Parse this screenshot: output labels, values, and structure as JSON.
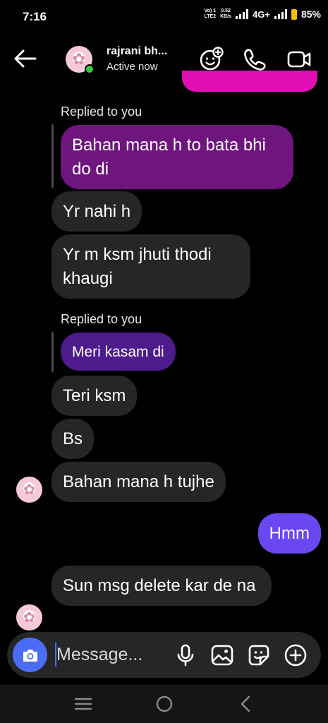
{
  "status": {
    "time": "7:16",
    "volte_top": "Vo) 1",
    "volte_bottom": "LTE2",
    "speed_top": "0.52",
    "speed_bottom": "KB/s",
    "network": "4G+",
    "battery": "85%"
  },
  "header": {
    "name": "rajrani bh...",
    "status": "Active now",
    "icons": [
      "back-arrow-icon",
      "add-effect-icon",
      "phone-icon",
      "video-icon"
    ]
  },
  "messages": [
    {
      "id": "m1",
      "replied_label": "Replied to you",
      "quote": "Bahan mana h to bata bhi do di",
      "quote_color": "#6e167d"
    },
    {
      "id": "m2",
      "text": "Yr nahi h"
    },
    {
      "id": "m3",
      "text": "Yr m ksm jhuti thodi khaugi"
    },
    {
      "id": "m4",
      "replied_label": "Replied to you",
      "quote": "Meri kasam di",
      "quote_color": "#4e1b8d"
    },
    {
      "id": "m5",
      "text": "Teri ksm"
    },
    {
      "id": "m6",
      "text": "Bs"
    },
    {
      "id": "m7",
      "text": "Bahan mana h tujhe"
    },
    {
      "id": "m8",
      "text": "Hmm",
      "outgoing": true,
      "color": "#6a47f0"
    },
    {
      "id": "m9",
      "text": "Sun msg delete kar de na"
    }
  ],
  "composer": {
    "placeholder": "Message...",
    "icons": [
      "camera-icon",
      "microphone-icon",
      "gallery-icon",
      "sticker-icon",
      "plus-icon"
    ]
  },
  "colors": {
    "incoming_bubble": "#262626",
    "outgoing_bubble": "#6a47f0",
    "accent": "#4a6cf7",
    "sent_pink": "#e00eb4"
  }
}
